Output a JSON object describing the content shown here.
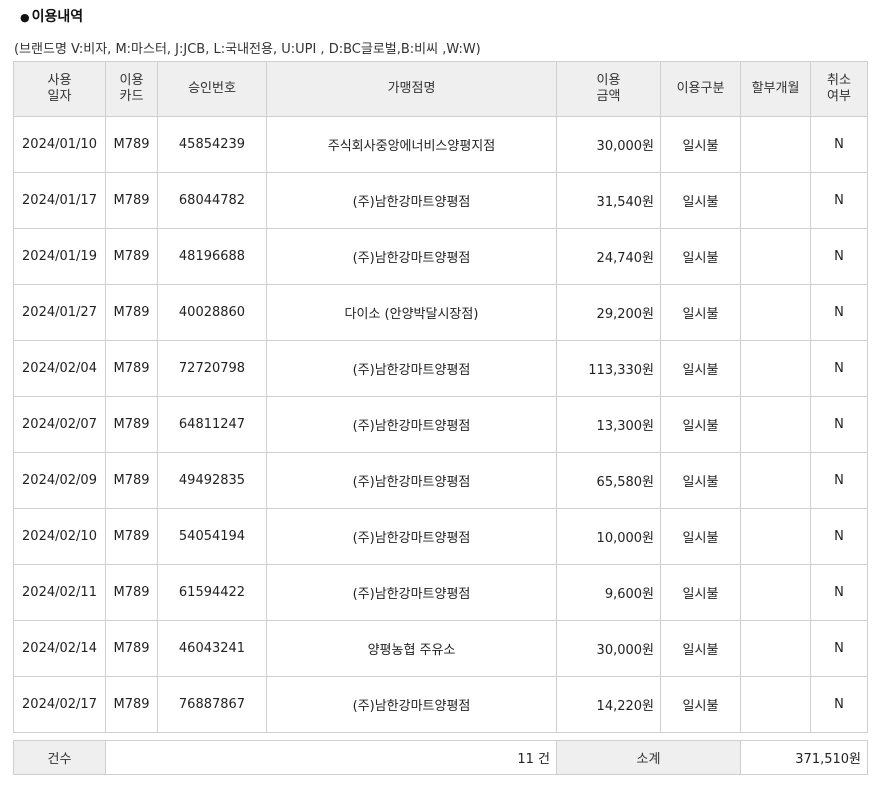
{
  "section": {
    "bullet": "●",
    "title": "이용내역"
  },
  "brand_note": "(브랜드명 V:비자, M:마스터, J:JCB, L:국내전용, U:UPI , D:BC글로벌,B:비씨 ,W:W)",
  "headers": {
    "date_l1": "사용",
    "date_l2": "일자",
    "card_l1": "이용",
    "card_l2": "카드",
    "approval": "승인번호",
    "merchant": "가맹점명",
    "amount_l1": "이용",
    "amount_l2": "금액",
    "type": "이용구분",
    "installment": "할부개월",
    "cancel_l1": "취소",
    "cancel_l2": "여부"
  },
  "rows": [
    {
      "date": "2024/01/10",
      "card": "M789",
      "approval": "45854239",
      "merchant": "주식회사중앙에너비스양평지점",
      "amount": "30,000원",
      "type": "일시불",
      "installment": "",
      "cancel": "N"
    },
    {
      "date": "2024/01/17",
      "card": "M789",
      "approval": "68044782",
      "merchant": "(주)남한강마트양평점",
      "amount": "31,540원",
      "type": "일시불",
      "installment": "",
      "cancel": "N"
    },
    {
      "date": "2024/01/19",
      "card": "M789",
      "approval": "48196688",
      "merchant": "(주)남한강마트양평점",
      "amount": "24,740원",
      "type": "일시불",
      "installment": "",
      "cancel": "N"
    },
    {
      "date": "2024/01/27",
      "card": "M789",
      "approval": "40028860",
      "merchant": "다이소 (안양박달시장점)",
      "amount": "29,200원",
      "type": "일시불",
      "installment": "",
      "cancel": "N"
    },
    {
      "date": "2024/02/04",
      "card": "M789",
      "approval": "72720798",
      "merchant": "(주)남한강마트양평점",
      "amount": "113,330원",
      "type": "일시불",
      "installment": "",
      "cancel": "N"
    },
    {
      "date": "2024/02/07",
      "card": "M789",
      "approval": "64811247",
      "merchant": "(주)남한강마트양평점",
      "amount": "13,300원",
      "type": "일시불",
      "installment": "",
      "cancel": "N"
    },
    {
      "date": "2024/02/09",
      "card": "M789",
      "approval": "49492835",
      "merchant": "(주)남한강마트양평점",
      "amount": "65,580원",
      "type": "일시불",
      "installment": "",
      "cancel": "N"
    },
    {
      "date": "2024/02/10",
      "card": "M789",
      "approval": "54054194",
      "merchant": "(주)남한강마트양평점",
      "amount": "10,000원",
      "type": "일시불",
      "installment": "",
      "cancel": "N"
    },
    {
      "date": "2024/02/11",
      "card": "M789",
      "approval": "61594422",
      "merchant": "(주)남한강마트양평점",
      "amount": "9,600원",
      "type": "일시불",
      "installment": "",
      "cancel": "N"
    },
    {
      "date": "2024/02/14",
      "card": "M789",
      "approval": "46043241",
      "merchant": "양평농협 주유소",
      "amount": "30,000원",
      "type": "일시불",
      "installment": "",
      "cancel": "N"
    },
    {
      "date": "2024/02/17",
      "card": "M789",
      "approval": "76887867",
      "merchant": "(주)남한강마트양평점",
      "amount": "14,220원",
      "type": "일시불",
      "installment": "",
      "cancel": "N"
    }
  ],
  "summary": {
    "count_label": "건수",
    "count_value": "11 건",
    "subtotal_label": "소계",
    "subtotal_value": "371,510원"
  }
}
